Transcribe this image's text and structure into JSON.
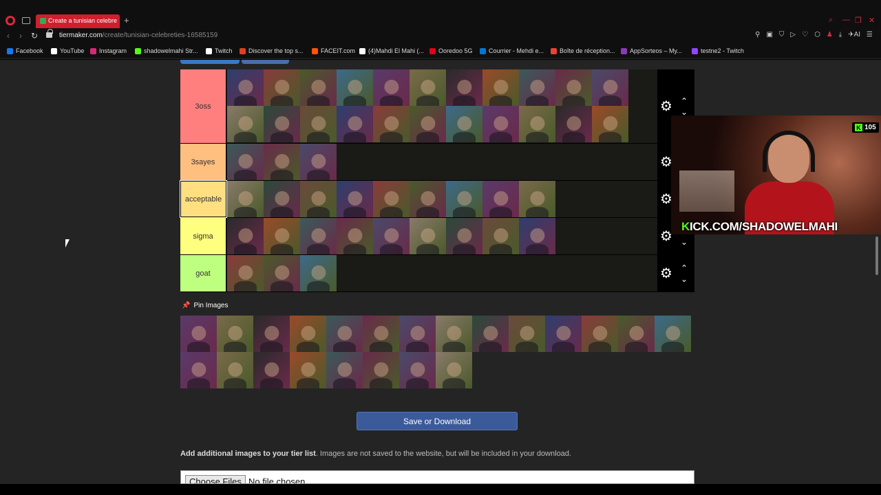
{
  "browser": {
    "tab_title": "Create a tunisian celebreti",
    "url_host": "tiermaker.com",
    "url_path": "/create/tunisian-celebreties-16585159",
    "bookmarks": [
      {
        "label": "Facebook",
        "color": "#1877f2"
      },
      {
        "label": "YouTube",
        "color": "#ffffff"
      },
      {
        "label": "Instagram",
        "color": "#d62976"
      },
      {
        "label": "shadowelmahi Str...",
        "color": "#53fc18"
      },
      {
        "label": "Twitch",
        "color": "#ffffff"
      },
      {
        "label": "Discover the top s...",
        "color": "#e0401c"
      },
      {
        "label": "FACEIT.com",
        "color": "#ff5500"
      },
      {
        "label": "(4)Mahdi El Mahi (...",
        "color": "#ffffff"
      },
      {
        "label": "Ooredoo 5G",
        "color": "#e2001a"
      },
      {
        "label": "Courrier - Mehdi e...",
        "color": "#0078d4"
      },
      {
        "label": "Boîte de réception...",
        "color": "#ea4335"
      },
      {
        "label": "AppSorteos – My...",
        "color": "#8a3ab9"
      },
      {
        "label": "testne2 - Twitch",
        "color": "#9146ff"
      }
    ]
  },
  "tiers": [
    {
      "label": "3oss",
      "color": "#ff7f7f",
      "count": 22
    },
    {
      "label": "3sayes",
      "color": "#ffbf7f",
      "count": 3
    },
    {
      "label": "acceptable",
      "color": "#ffdf7f",
      "count": 9
    },
    {
      "label": "sigma",
      "color": "#ffff7f",
      "count": 9
    },
    {
      "label": "goat",
      "color": "#bfff7f",
      "count": 3
    }
  ],
  "pin": {
    "title": "Pin Images",
    "count": 22
  },
  "save_button": "Save or Download",
  "add_images": {
    "bold": "Add additional images to your tier list",
    "rest": ". Images are not saved to the website, but will be included in your download."
  },
  "file_input": {
    "button": "Choose Files",
    "status": "No file chosen"
  },
  "stream": {
    "viewers": "105",
    "channel_k": "K",
    "channel_rest": "ICK.COM/SHADOWELMAHI"
  }
}
